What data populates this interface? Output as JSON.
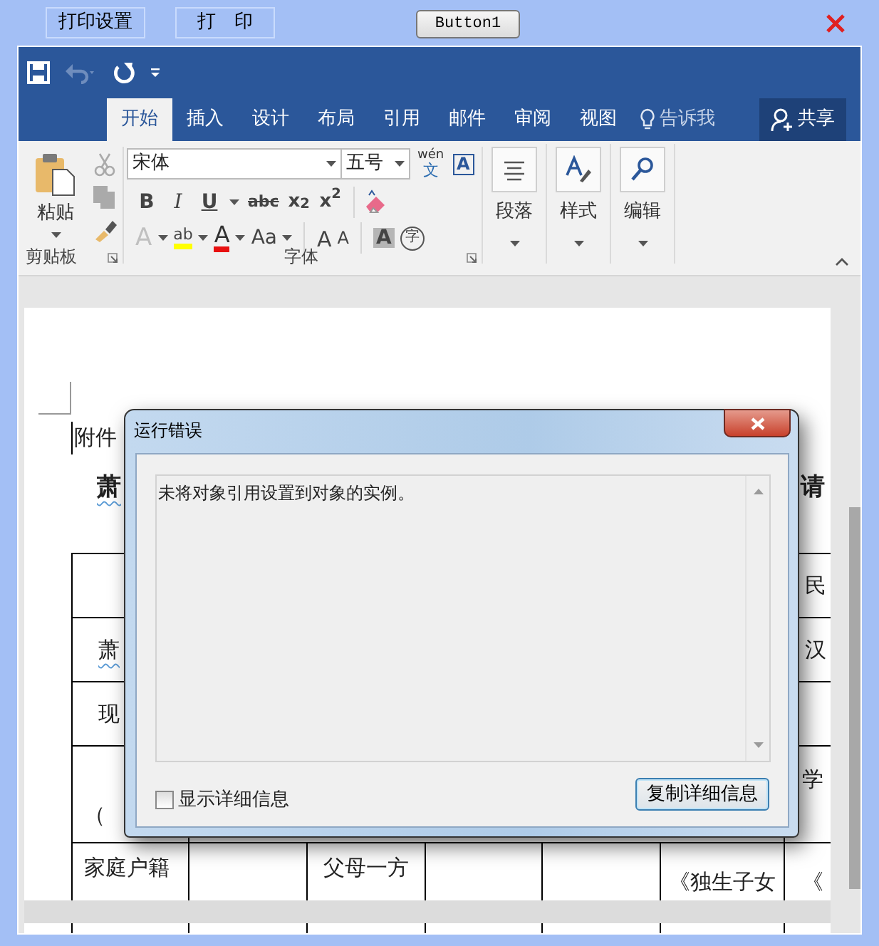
{
  "top_bar": {
    "buttons": [
      {
        "label": "打印设置"
      },
      {
        "label": "打　印"
      }
    ],
    "test_button": "Button1"
  },
  "quick_access": [
    {
      "kind": "save",
      "disabled": false
    },
    {
      "kind": "undo",
      "disabled": true
    },
    {
      "kind": "redo",
      "disabled": false
    },
    {
      "kind": "customize",
      "disabled": false
    }
  ],
  "tabs": [
    {
      "label": "开始",
      "selected": true
    },
    {
      "label": "插入",
      "selected": false
    },
    {
      "label": "设计",
      "selected": false
    },
    {
      "label": "布局",
      "selected": false
    },
    {
      "label": "引用",
      "selected": false
    },
    {
      "label": "邮件",
      "selected": false
    },
    {
      "label": "审阅",
      "selected": false
    },
    {
      "label": "视图",
      "selected": false
    }
  ],
  "tell_me": "告诉我",
  "share": "共享",
  "clipboard": {
    "paste": "粘贴",
    "tools": [
      {
        "kind": "cut",
        "disabled": true
      },
      {
        "kind": "copy",
        "disabled": true
      },
      {
        "kind": "painter",
        "disabled": false
      }
    ],
    "label": "剪贴板"
  },
  "font": {
    "face": "宋体",
    "size": "五号",
    "phonetic": "wén",
    "phonetic_char": "文",
    "border_char": "A",
    "row2": [
      {
        "kind": "bold",
        "glyph": "B"
      },
      {
        "kind": "italic",
        "glyph": "I"
      },
      {
        "kind": "underline",
        "glyph": "U"
      },
      {
        "kind": "strike",
        "glyph": "abc"
      },
      {
        "kind": "sub",
        "glyph": "x$_{2}$"
      },
      {
        "kind": "sup",
        "glyph": "x$^{2}$"
      }
    ],
    "row3": [
      {
        "kind": "effects",
        "glyph": "A",
        "disabled": true
      },
      {
        "kind": "highlight",
        "glyph": "ab",
        "disabled": false
      },
      {
        "kind": "color",
        "glyph": "A",
        "disabled": false
      },
      {
        "kind": "case",
        "glyph": "Aa",
        "disabled": false
      },
      {
        "kind": "grow",
        "glyph": "A",
        "disabled": false
      },
      {
        "kind": "shrink",
        "glyph": "A",
        "disabled": false
      },
      {
        "kind": "shade",
        "glyph": "A",
        "disabled": false
      },
      {
        "kind": "enclose",
        "glyph": "字",
        "disabled": false
      }
    ],
    "label": "字体"
  },
  "groups": [
    {
      "kind": "paragraph",
      "label": "段落"
    },
    {
      "kind": "styles",
      "label": "样式"
    },
    {
      "kind": "editing",
      "label": "编辑"
    }
  ],
  "document": {
    "attachment": "附件",
    "title_left": "萧",
    "title_right": "请",
    "rows": [
      {
        "kind": "split",
        "left": "",
        "right": "民"
      },
      {
        "kind": "split",
        "left": "萧",
        "right": "汉"
      },
      {
        "kind": "split",
        "left": "现",
        "right": ""
      },
      {
        "kind": "split",
        "left": "（",
        "right": "学"
      },
      {
        "kind": "full",
        "cells": [
          "家庭户籍",
          "",
          "父母一方",
          "",
          "",
          "《独生子女",
          "《"
        ]
      }
    ]
  },
  "dialog": {
    "title": "运行错误",
    "message": "未将对象引用设置到对象的实例。",
    "checkbox": {
      "label": "显示详细信息",
      "checked": false
    },
    "button": "复制详细信息"
  }
}
